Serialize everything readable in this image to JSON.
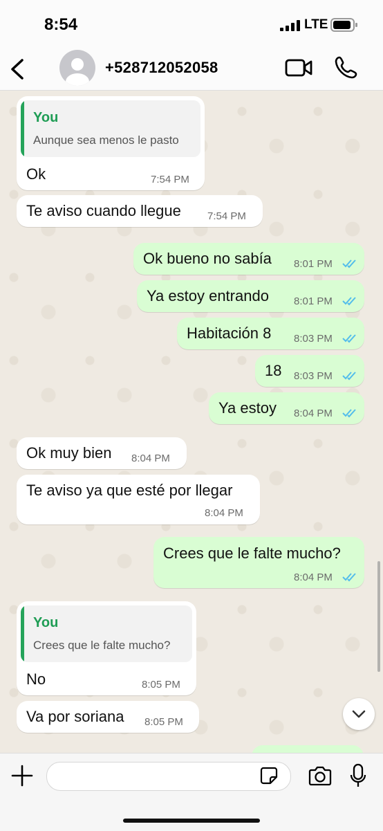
{
  "status_bar": {
    "time": "8:54",
    "network": "LTE"
  },
  "header": {
    "contact": "+528712052058",
    "icons": [
      "back-chevron-icon",
      "avatar-icon",
      "video-call-icon",
      "phone-icon"
    ]
  },
  "messages": [
    {
      "direction": "in",
      "quote_name": "You",
      "quote_text": "Aunque sea menos le pasto",
      "text": "Ok",
      "time": "7:54 PM"
    },
    {
      "direction": "in",
      "text": "Te aviso cuando llegue",
      "time": "7:54 PM"
    },
    {
      "direction": "out",
      "text": "Ok bueno no sabía",
      "time": "8:01 PM",
      "status": "read"
    },
    {
      "direction": "out",
      "text": "Ya estoy entrando",
      "time": "8:01 PM",
      "status": "read"
    },
    {
      "direction": "out",
      "text": "Habitación 8",
      "time": "8:03 PM",
      "status": "read"
    },
    {
      "direction": "out",
      "text": "18",
      "time": "8:03 PM",
      "status": "read"
    },
    {
      "direction": "out",
      "text": "Ya estoy",
      "time": "8:04 PM",
      "status": "read"
    },
    {
      "direction": "in",
      "text": "Ok muy bien",
      "time": "8:04 PM"
    },
    {
      "direction": "in",
      "text": "Te aviso ya que esté por llegar",
      "time": "8:04 PM"
    },
    {
      "direction": "out",
      "text": "Crees que le falte mucho?",
      "time": "8:04 PM",
      "status": "read"
    },
    {
      "direction": "in",
      "quote_name": "You",
      "quote_text": "Crees que le falte mucho?",
      "text": "No",
      "time": "8:05 PM"
    },
    {
      "direction": "in",
      "text": "Va por soriana",
      "time": "8:05 PM"
    }
  ],
  "input_bar": {
    "message_value": "",
    "icons": [
      "plus-icon",
      "sticker-icon",
      "camera-icon",
      "microphone-icon"
    ]
  },
  "colors": {
    "incoming": "#ffffff",
    "outgoing": "#d9fdd3",
    "read_ticks": "#53bdeb",
    "quote_accent": "#25a35a"
  }
}
